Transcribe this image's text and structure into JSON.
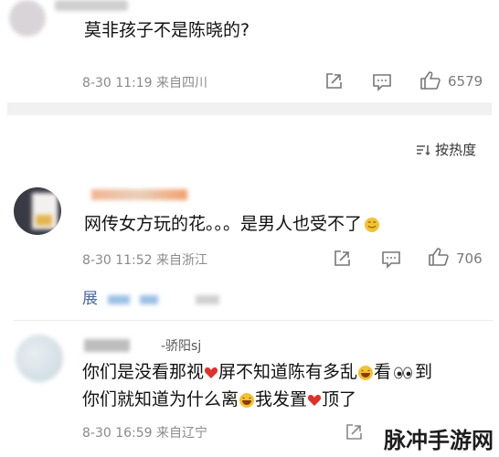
{
  "comments": [
    {
      "text": "莫非孩子不是陈晓的?",
      "meta": {
        "date": "8-30",
        "time": "11:19",
        "location": "来自四川"
      },
      "likes": "6579"
    },
    {
      "text": "网传女方玩的花。。。是男人也受不了",
      "meta": {
        "date": "8-30",
        "time": "11:52",
        "location": "来自浙江"
      },
      "likes": "706",
      "expand": "展"
    },
    {
      "username_visible": "-骄阳sj",
      "line1": {
        "a": "你们是没看那视",
        "b": "屏不知道陈有多乱",
        "c": "看",
        "d": "到"
      },
      "line2": {
        "a": "你们就知道为什么离",
        "b": "我发置",
        "c": "顶了"
      },
      "meta": {
        "date": "8-30",
        "time": "16:59",
        "location": "来自辽宁"
      }
    }
  ],
  "sort": {
    "label": "按热度"
  },
  "watermark": "脉冲手游网",
  "colors": {
    "heart": "#e0302a",
    "emoji": "#f2c231",
    "meta": "#8a8a8a",
    "separator": "#f1f1f1"
  },
  "icons": [
    "share-icon",
    "comment-icon",
    "like-icon",
    "sort-icon",
    "heart-emoji",
    "smile-emoji",
    "laugh-emoji",
    "eyes-emoji"
  ]
}
